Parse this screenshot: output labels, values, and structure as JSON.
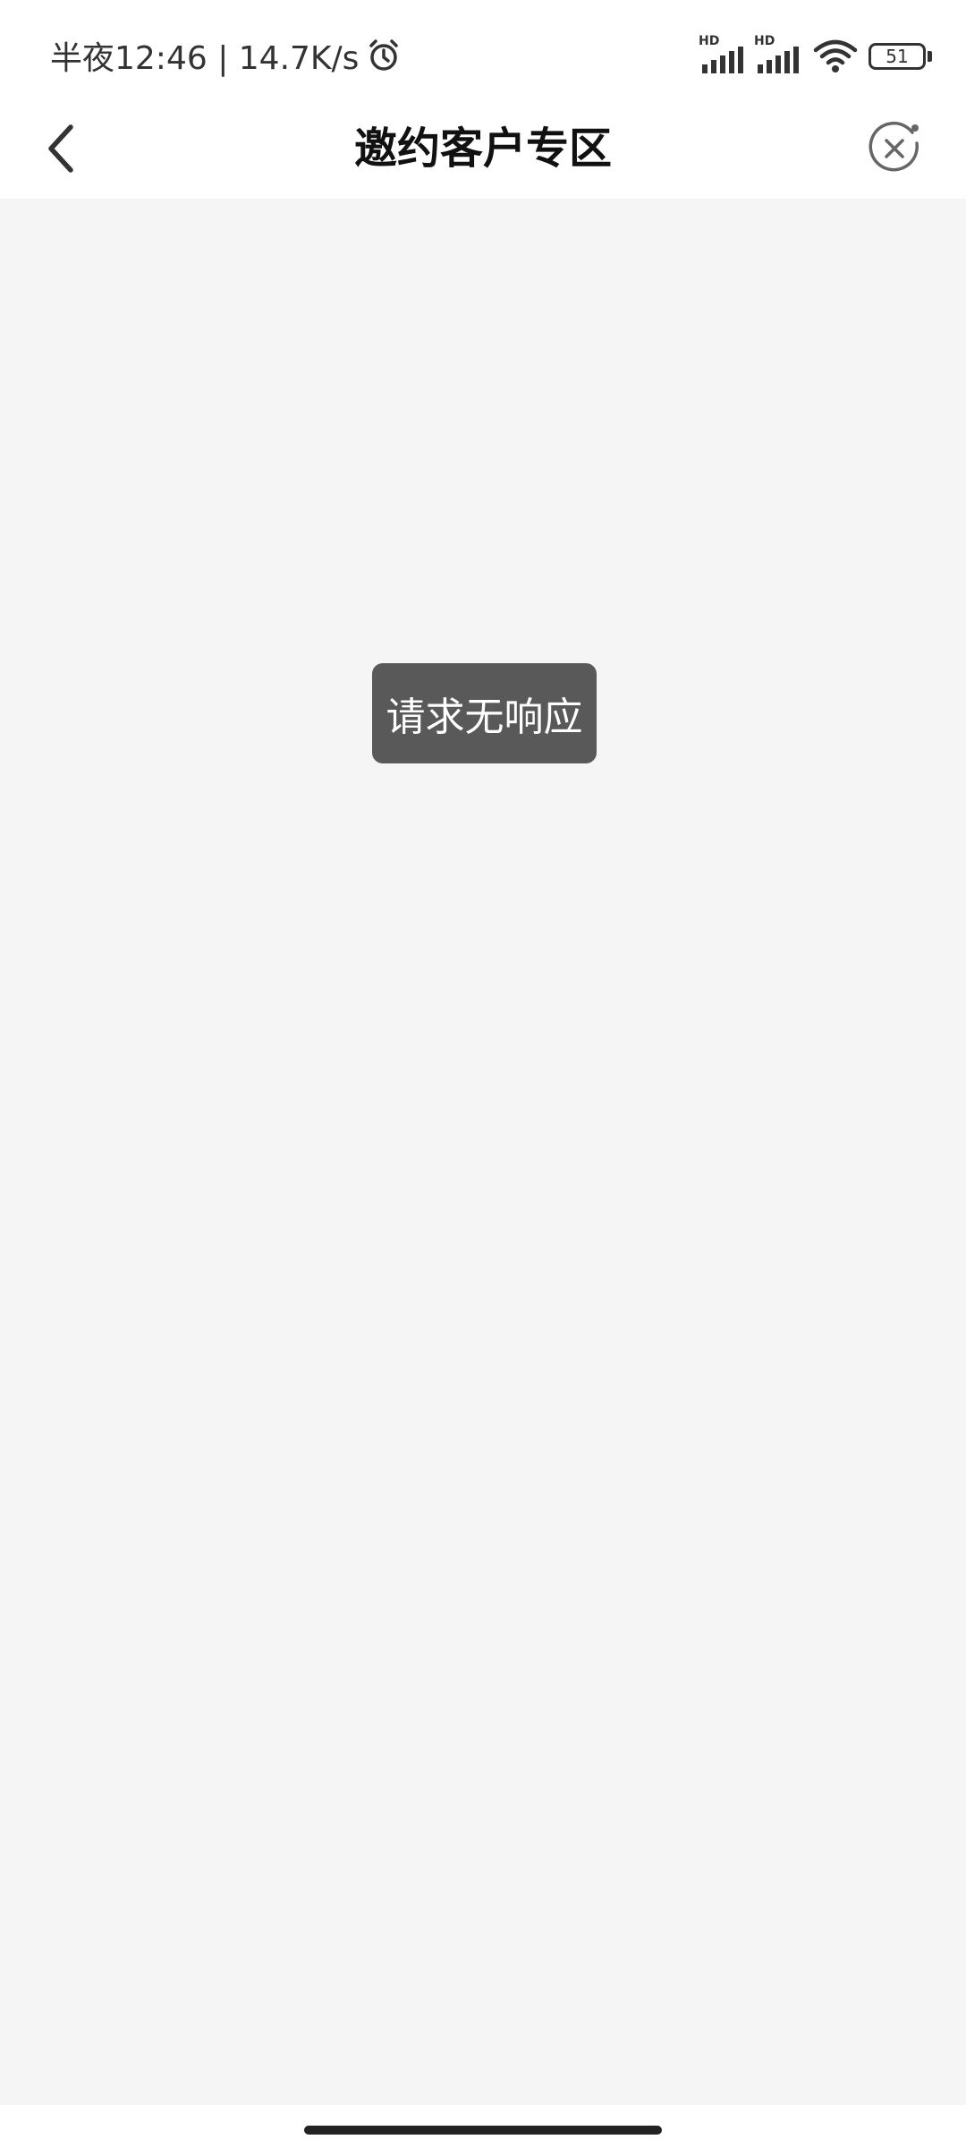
{
  "status_bar": {
    "time_text": "半夜12:46 | 14.7K/s",
    "battery_level": "51",
    "signal_1_label": "HD",
    "signal_2_label": "HD",
    "icons": [
      "alarm-icon",
      "signal-icon",
      "signal-icon",
      "wifi-icon",
      "battery-icon"
    ]
  },
  "nav": {
    "title": "邀约客户专区",
    "back_icon": "chevron-left-icon",
    "close_icon": "close-circle-icon"
  },
  "toast": {
    "message": "请求无响应"
  },
  "colors": {
    "content_background": "#f5f5f5",
    "toast_background": "#595959",
    "title_color": "#111111"
  }
}
